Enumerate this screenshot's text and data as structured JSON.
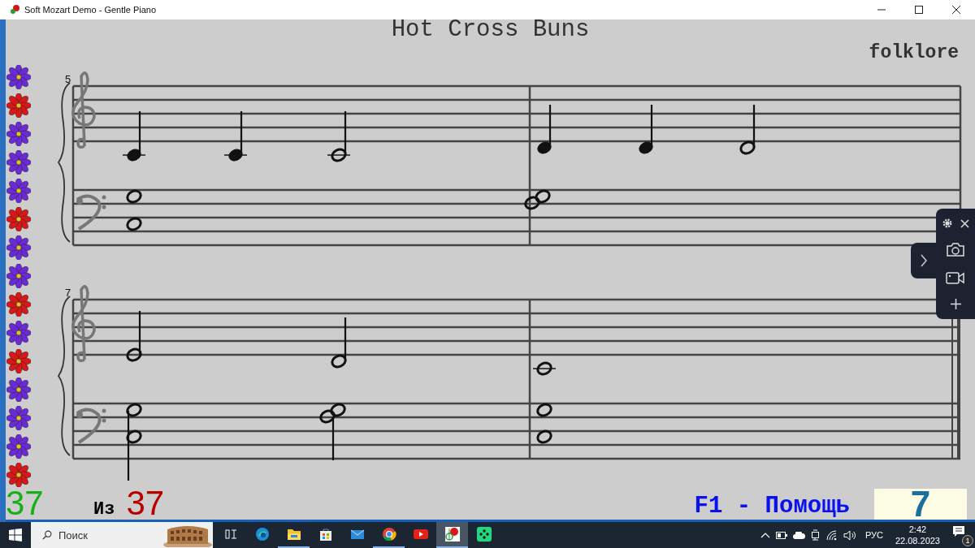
{
  "window": {
    "title": "Soft Mozart Demo - Gentle Piano"
  },
  "score": {
    "title": "Hot Cross Buns",
    "composer": "folklore",
    "systems": [
      {
        "measure_number": "5"
      },
      {
        "measure_number": "7"
      }
    ]
  },
  "flowers": [
    {
      "color": "#6a2bd6"
    },
    {
      "color": "#d81818"
    },
    {
      "color": "#6a2bd6"
    },
    {
      "color": "#6a2bd6"
    },
    {
      "color": "#6a2bd6"
    },
    {
      "color": "#d81818"
    },
    {
      "color": "#6a2bd6"
    },
    {
      "color": "#6a2bd6"
    },
    {
      "color": "#d81818"
    },
    {
      "color": "#6a2bd6"
    },
    {
      "color": "#d81818"
    },
    {
      "color": "#6a2bd6"
    },
    {
      "color": "#6a2bd6"
    },
    {
      "color": "#6a2bd6"
    },
    {
      "color": "#d81818"
    }
  ],
  "footer": {
    "current": "37",
    "of_label": "Из",
    "total": "37",
    "help": "F1 - Помощь",
    "counter": "7"
  },
  "taskbar": {
    "search_placeholder": "Поиск",
    "apps": [
      {
        "kind": "task-view",
        "running": false,
        "selected": false
      },
      {
        "kind": "edge",
        "running": false,
        "selected": false
      },
      {
        "kind": "explorer",
        "running": true,
        "selected": false
      },
      {
        "kind": "store",
        "running": false,
        "selected": false
      },
      {
        "kind": "mail",
        "running": false,
        "selected": false
      },
      {
        "kind": "chrome",
        "running": true,
        "selected": false
      },
      {
        "kind": "youtube",
        "running": false,
        "selected": false
      },
      {
        "kind": "mozart",
        "running": true,
        "selected": true
      },
      {
        "kind": "green-app",
        "running": false,
        "selected": false
      }
    ],
    "language": "РУС",
    "time": "2:42",
    "date": "22.08.2023",
    "notification_count": "1"
  }
}
